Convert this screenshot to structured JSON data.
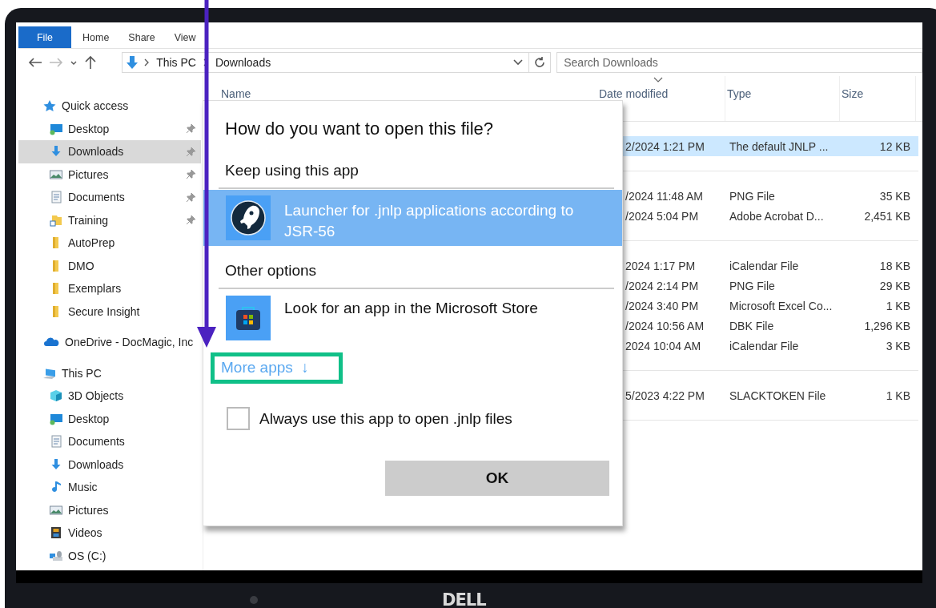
{
  "ribbon_tabs": [
    {
      "label": "File",
      "selected": true
    },
    {
      "label": "Home",
      "selected": false
    },
    {
      "label": "Share",
      "selected": false
    },
    {
      "label": "View",
      "selected": false
    }
  ],
  "navigation": {
    "back_disabled": false,
    "forward_disabled": true
  },
  "address": {
    "path": [
      "This PC",
      "Downloads"
    ]
  },
  "search": {
    "placeholder": "Search Downloads"
  },
  "sidebar": {
    "items": [
      {
        "label": "Quick access",
        "kind": "star",
        "children": [
          {
            "label": "Desktop",
            "kind": "desktop",
            "pinned": true,
            "selected": false
          },
          {
            "label": "Downloads",
            "kind": "download",
            "pinned": true,
            "selected": true
          },
          {
            "label": "Pictures",
            "kind": "pictures",
            "pinned": true,
            "selected": false
          },
          {
            "label": "Documents",
            "kind": "documents",
            "pinned": true,
            "selected": false
          },
          {
            "label": "Training",
            "kind": "shortcut",
            "pinned": true,
            "selected": false
          },
          {
            "label": "AutoPrep",
            "kind": "folder",
            "pinned": false,
            "selected": false
          },
          {
            "label": "DMO",
            "kind": "folder",
            "pinned": false,
            "selected": false
          },
          {
            "label": "Exemplars",
            "kind": "folder",
            "pinned": false,
            "selected": false
          },
          {
            "label": "Secure Insight",
            "kind": "folder",
            "pinned": false,
            "selected": false
          }
        ]
      },
      {
        "label": "OneDrive - DocMagic, Inc",
        "kind": "cloud"
      },
      {
        "label": "This PC",
        "kind": "pc",
        "children": [
          {
            "label": "3D Objects",
            "kind": "cube",
            "pinned": false,
            "selected": false
          },
          {
            "label": "Desktop",
            "kind": "desktop",
            "pinned": false,
            "selected": false
          },
          {
            "label": "Documents",
            "kind": "documents",
            "pinned": false,
            "selected": false
          },
          {
            "label": "Downloads",
            "kind": "download",
            "pinned": false,
            "selected": false
          },
          {
            "label": "Music",
            "kind": "music",
            "pinned": false,
            "selected": false
          },
          {
            "label": "Pictures",
            "kind": "pictures",
            "pinned": false,
            "selected": false
          },
          {
            "label": "Videos",
            "kind": "videos",
            "pinned": false,
            "selected": false
          },
          {
            "label": "OS (C:)",
            "kind": "drive",
            "pinned": false,
            "selected": false
          }
        ]
      }
    ]
  },
  "table": {
    "columns": [
      {
        "label": "Name",
        "sorted": false
      },
      {
        "label": "Date modified",
        "sorted": true
      },
      {
        "label": "Type",
        "sorted": false
      },
      {
        "label": "Size",
        "sorted": false
      }
    ],
    "groups": [
      {
        "rows": [
          {
            "date": "2/2024 1:21 PM",
            "type": "The default JNLP ...",
            "size": "12 KB",
            "selected": true
          }
        ]
      },
      {
        "rows": [
          {
            "date": "/2024 11:48 AM",
            "type": "PNG File",
            "size": "35 KB",
            "selected": false
          },
          {
            "date": "/2024 5:04 PM",
            "type": "Adobe Acrobat D...",
            "size": "2,451 KB",
            "selected": false
          }
        ]
      },
      {
        "rows": [
          {
            "date": "2024 1:17 PM",
            "type": "iCalendar File",
            "size": "18 KB",
            "selected": false
          },
          {
            "date": "/2024 2:14 PM",
            "type": "PNG File",
            "size": "29 KB",
            "selected": false
          },
          {
            "date": "/2024 3:40 PM",
            "type": "Microsoft Excel Co...",
            "size": "1 KB",
            "selected": false
          },
          {
            "date": "/2024 10:56 AM",
            "type": "DBK File",
            "size": "1,296 KB",
            "selected": false
          },
          {
            "date": "2024 10:04 AM",
            "type": "iCalendar File",
            "size": "3 KB",
            "selected": false
          }
        ]
      },
      {
        "rows": [
          {
            "date": "5/2023 4:22 PM",
            "type": "SLACKTOKEN File",
            "size": "1 KB",
            "selected": false
          }
        ]
      }
    ]
  },
  "dialog": {
    "title": "How do you want to open this file?",
    "keep_heading": "Keep using this app",
    "apps": [
      {
        "label": "Launcher for .jnlp applications according to JSR-56",
        "kind": "rocket",
        "selected": true
      }
    ],
    "other_heading": "Other options",
    "other_apps": [
      {
        "label": "Look for an app in the Microsoft Store",
        "kind": "store",
        "selected": false
      }
    ],
    "more_apps": {
      "label": "More apps",
      "icon": "↓",
      "highlighted": true
    },
    "checkbox": {
      "label": "Always use this app to open .jnlp files",
      "checked": false
    },
    "ok_button": "OK"
  },
  "bezel_logo": "DELL"
}
